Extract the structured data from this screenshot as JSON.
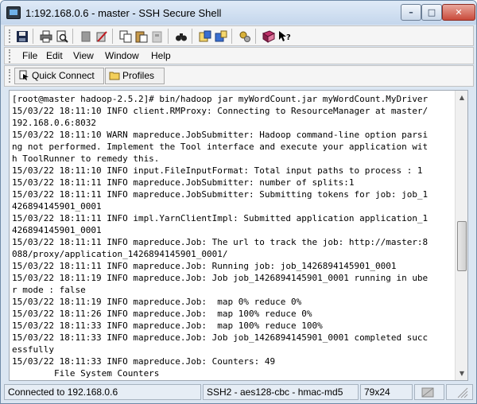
{
  "window": {
    "title": "1:192.168.0.6 - master - SSH Secure Shell",
    "minimize_label": "–",
    "maximize_label": "□",
    "close_label": "✕"
  },
  "toolbar": {
    "icons": [
      "save-icon",
      "print-icon",
      "print-preview-icon",
      "disconnect-icon",
      "disconnect-all-icon",
      "copy-icon",
      "paste-icon",
      "paste-disabled-icon",
      "find-icon",
      "file-transfer-icon",
      "new-file-transfer-icon",
      "settings-icon",
      "help-book-icon",
      "context-help-icon"
    ]
  },
  "menu": {
    "file": "File",
    "edit": "Edit",
    "view": "View",
    "window": "Window",
    "help": "Help"
  },
  "quickbar": {
    "quick_connect": "Quick Connect",
    "profiles": "Profiles"
  },
  "terminal": {
    "lines": [
      "[root@master hadoop-2.5.2]# bin/hadoop jar myWordCount.jar myWordCount.MyDriver",
      "15/03/22 18:11:10 INFO client.RMProxy: Connecting to ResourceManager at master/",
      "192.168.0.6:8032",
      "15/03/22 18:11:10 WARN mapreduce.JobSubmitter: Hadoop command-line option parsi",
      "ng not performed. Implement the Tool interface and execute your application wit",
      "h ToolRunner to remedy this.",
      "15/03/22 18:11:10 INFO input.FileInputFormat: Total input paths to process : 1",
      "15/03/22 18:11:11 INFO mapreduce.JobSubmitter: number of splits:1",
      "15/03/22 18:11:11 INFO mapreduce.JobSubmitter: Submitting tokens for job: job_1",
      "426894145901_0001",
      "15/03/22 18:11:11 INFO impl.YarnClientImpl: Submitted application application_1",
      "426894145901_0001",
      "15/03/22 18:11:11 INFO mapreduce.Job: The url to track the job: http://master:8",
      "088/proxy/application_1426894145901_0001/",
      "15/03/22 18:11:11 INFO mapreduce.Job: Running job: job_1426894145901_0001",
      "15/03/22 18:11:19 INFO mapreduce.Job: Job job_1426894145901_0001 running in ube",
      "r mode : false",
      "15/03/22 18:11:19 INFO mapreduce.Job:  map 0% reduce 0%",
      "15/03/22 18:11:26 INFO mapreduce.Job:  map 100% reduce 0%",
      "15/03/22 18:11:33 INFO mapreduce.Job:  map 100% reduce 100%",
      "15/03/22 18:11:33 INFO mapreduce.Job: Job job_1426894145901_0001 completed succ",
      "essfully",
      "15/03/22 18:11:33 INFO mapreduce.Job: Counters: 49",
      "        File System Counters"
    ],
    "scroll_position": 0.55,
    "scroll_visible_fraction": 0.19
  },
  "status": {
    "connected": "Connected to 192.168.0.6",
    "cipher": "SSH2 - aes128-cbc - hmac-md5",
    "size": "79x24"
  }
}
